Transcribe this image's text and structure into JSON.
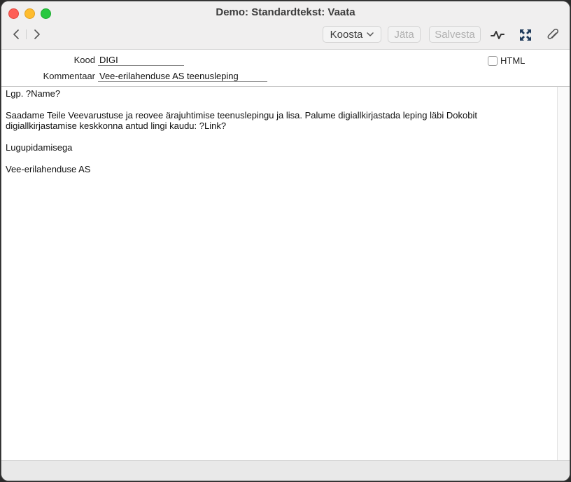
{
  "window": {
    "title": "Demo: Standardtekst: Vaata"
  },
  "toolbar": {
    "koosta_label": "Koosta",
    "jata_label": "Jäta",
    "salvesta_label": "Salvesta"
  },
  "form": {
    "kood_label": "Kood",
    "kood_value": "DIGI",
    "kommentaar_label": "Kommentaar",
    "kommentaar_value": "Vee-erilahenduse AS teenusleping",
    "html_label": "HTML",
    "html_checked": false
  },
  "editor": {
    "lines": [
      "Lgp. ?Name?",
      "",
      "Saadame Teile Veevarustuse ja reovee ärajuhtimise teenuslepingu ja lisa. Palume digiallkirjastada leping läbi Dokobit",
      "digiallkirjastamise keskkonna antud lingi kaudu: ?Link?",
      "",
      "Lugupidamisega",
      "",
      "Vee-erilahenduse AS"
    ]
  },
  "icons": {
    "back": "chevron-left-icon",
    "forward": "chevron-right-icon",
    "activity": "activity-icon",
    "expand": "expand-icon",
    "attach": "paperclip-icon"
  }
}
